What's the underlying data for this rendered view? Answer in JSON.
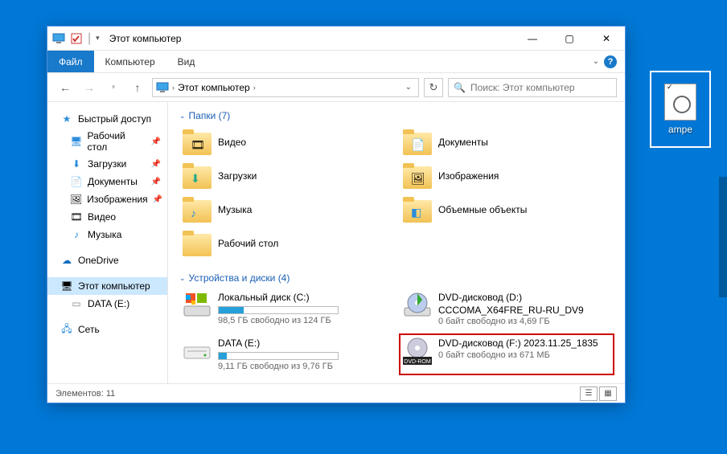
{
  "desktop": {
    "icon_label": "ampe"
  },
  "window": {
    "title": "Этот компьютер",
    "ribbon": {
      "file": "Файл",
      "tabs": [
        "Компьютер",
        "Вид"
      ]
    },
    "nav": {
      "location": "Этот компьютер",
      "search_placeholder": "Поиск: Этот компьютер"
    },
    "sidebar": {
      "quick": {
        "label": "Быстрый доступ",
        "items": [
          {
            "label": "Рабочий стол",
            "pinned": true
          },
          {
            "label": "Загрузки",
            "pinned": true
          },
          {
            "label": "Документы",
            "pinned": true
          },
          {
            "label": "Изображения",
            "pinned": true
          },
          {
            "label": "Видео",
            "pinned": false
          },
          {
            "label": "Музыка",
            "pinned": false
          }
        ]
      },
      "onedrive": "OneDrive",
      "thispc": "Этот компьютер",
      "data_e": "DATA (E:)",
      "network": "Сеть"
    },
    "sections": {
      "folders": {
        "title": "Папки (7)",
        "items": [
          "Видео",
          "Документы",
          "Загрузки",
          "Изображения",
          "Музыка",
          "Объемные объекты",
          "Рабочий стол"
        ]
      },
      "drives": {
        "title": "Устройства и диски (4)",
        "items": [
          {
            "name": "Локальный диск (C:)",
            "sub": "98,5 ГБ свободно из 124 ГБ",
            "fill": 21,
            "icon": "win"
          },
          {
            "name": "DVD-дисковод (D:) CCCOMA_X64FRE_RU-RU_DV9",
            "sub": "0 байт свободно из 4,69 ГБ",
            "icon": "dvd-green"
          },
          {
            "name": "DATA (E:)",
            "sub": "9,11 ГБ свободно из 9,76 ГБ",
            "fill": 7,
            "icon": "hdd"
          },
          {
            "name": "DVD-дисковод (F:) 2023.11.25_1835",
            "sub": "0 байт свободно из 671 МБ",
            "icon": "dvd-rom",
            "highlight": true
          }
        ]
      }
    },
    "status": "Элементов: 11"
  }
}
